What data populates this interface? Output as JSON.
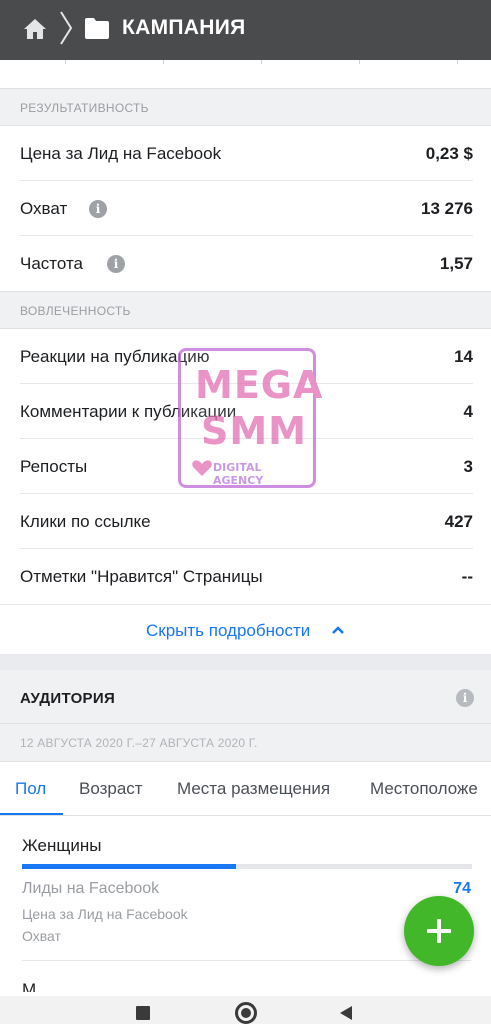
{
  "header": {
    "title": "КАМПАНИЯ"
  },
  "performance": {
    "section_title": "РЕЗУЛЬТАТИВНОСТЬ",
    "rows": [
      {
        "label": "Цена за Лид на Facebook",
        "value": "0,23 $"
      },
      {
        "label": "Охват",
        "value": "13 276",
        "info": true
      },
      {
        "label": "Частота",
        "value": "1,57",
        "info": true
      }
    ]
  },
  "engagement": {
    "section_title": "ВОВЛЕЧЕННОСТЬ",
    "rows": [
      {
        "label": "Реакции на публикацию",
        "value": "14"
      },
      {
        "label": "Комментарии к публикации",
        "value": "4"
      },
      {
        "label": "Репосты",
        "value": "3"
      },
      {
        "label": "Клики по ссылке",
        "value": "427"
      },
      {
        "label": "Отметки \"Нравится\" Страницы",
        "value": "--"
      }
    ]
  },
  "details_toggle": {
    "label": "Скрыть подробности"
  },
  "audience": {
    "title": "АУДИТОРИЯ",
    "date_range": "12 АВГУСТА 2020 Г.–27 АВГУСТА 2020 Г.",
    "tabs": [
      "Пол",
      "Возраст",
      "Места размещения",
      "Местоположе"
    ],
    "active_tab": "Пол",
    "breakdown": {
      "name": "Женщины",
      "share": 0.476,
      "metric_1_label": "Лиды на Facebook",
      "metric_1_value": "74",
      "metric_2_label": "Цена за Лид на Facebook",
      "metric_3_label": "Охват",
      "next_item": "М"
    }
  },
  "watermark": {
    "line1": "MEGA",
    "line2": "SMM",
    "tagline": "DIGITAL AGENCY"
  },
  "colors": {
    "accent": "#1877f2",
    "fab": "#42b72a",
    "topbar": "#4a4b4d"
  }
}
